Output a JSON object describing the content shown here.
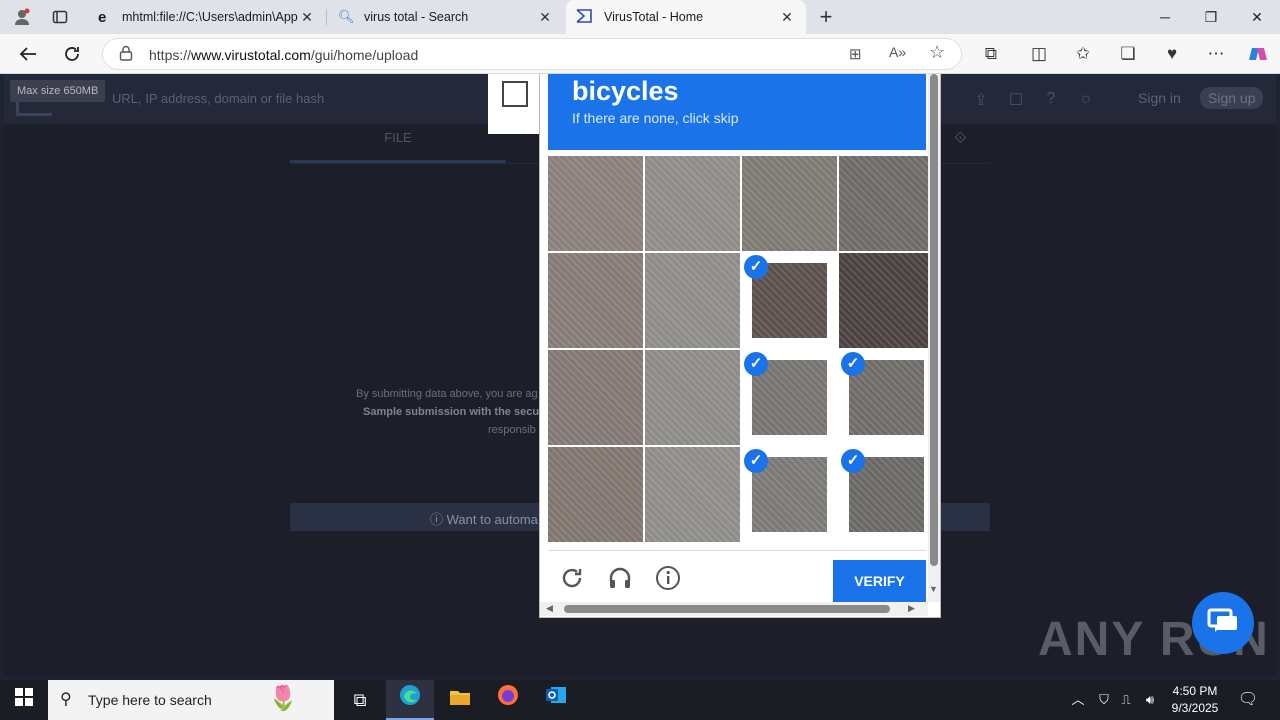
{
  "browser": {
    "tabs": [
      {
        "title": "mhtml:file://C:\\Users\\admin\\AppD",
        "icon": "ie-page-icon"
      },
      {
        "title": "virus total - Search",
        "icon": "search-icon"
      },
      {
        "title": "VirusTotal - Home",
        "icon": "virustotal-icon"
      }
    ],
    "url_prefix": "https://",
    "url_host": "www.virustotal.com",
    "url_path": "/gui/home/upload"
  },
  "vt": {
    "search_placeholder": "URL, IP address, domain or file hash",
    "max_size": "Max size 650MB",
    "sign_in": "Sign in",
    "sign_up": "Sign up",
    "file_tab": "FILE",
    "tos_line1": "By submitting data above, you are ag",
    "tos_line2": "Sample submission with the secu",
    "tos_line3": "responsib",
    "want_bar": "Want to automa"
  },
  "captcha": {
    "target": "bicycles",
    "subtitle": "If there are none, click skip",
    "verify_label": "VERIFY",
    "selected": [
      false,
      false,
      false,
      false,
      false,
      false,
      true,
      false,
      false,
      false,
      true,
      true,
      false,
      false,
      true,
      true
    ],
    "tile_colors": [
      "#8a7f7b",
      "#8f8c88",
      "#7d7a73",
      "#6e6a66",
      "#857a76",
      "#8e8c89",
      "#5a504c",
      "#4a4240",
      "#827774",
      "#8d8b88",
      "#767370",
      "#6f6c68",
      "#80756f",
      "#8e8c88",
      "#7b7976",
      "#6a6865"
    ]
  },
  "watermark": "ANY RUN",
  "taskbar": {
    "search_placeholder": "Type here to search",
    "time": "4:50 PM",
    "date": "9/3/2025"
  },
  "colors": {
    "accent": "#1a73e8"
  }
}
